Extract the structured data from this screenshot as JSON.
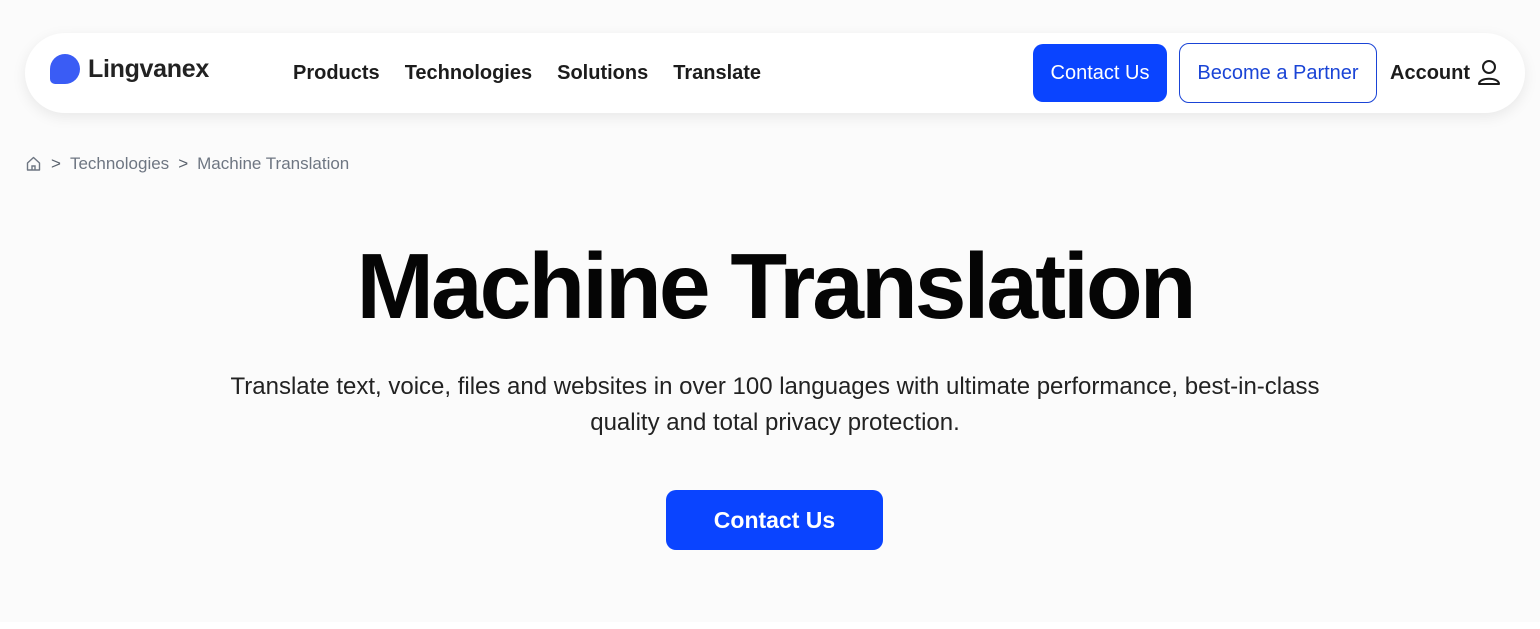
{
  "brand": {
    "name": "Lingvanex",
    "accent_color": "#3a5cf5",
    "logo_icon": "speech-bubble-logo"
  },
  "nav": {
    "items": [
      {
        "label": "Products"
      },
      {
        "label": "Technologies"
      },
      {
        "label": "Solutions"
      },
      {
        "label": "Translate"
      }
    ],
    "contact_label": "Contact Us",
    "partner_label": "Become a Partner",
    "account_label": "Account",
    "account_icon": "user-icon",
    "primary_color": "#0a44ff"
  },
  "breadcrumb": {
    "home_icon": "home-icon",
    "separator": ">",
    "items": [
      {
        "label": "Technologies"
      },
      {
        "label": "Machine Translation"
      }
    ]
  },
  "hero": {
    "title": "Machine Translation",
    "subtitle": "Translate text, voice, files and websites in over 100 languages with ultimate performance, best-in-class quality and total privacy protection.",
    "cta_label": "Contact Us"
  }
}
